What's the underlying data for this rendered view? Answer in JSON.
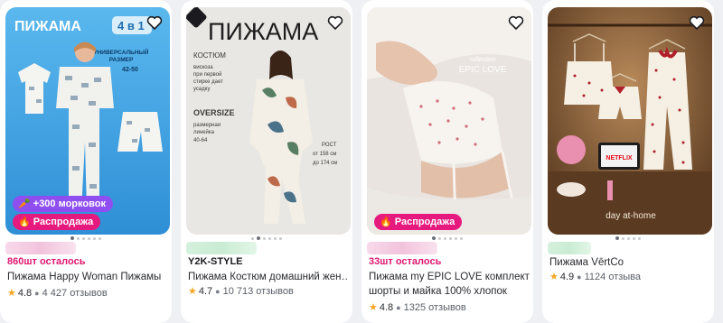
{
  "products": [
    {
      "image_title": "ПИЖАМА",
      "image_badge": "4 в 1",
      "image_note_1": "УНИВЕРСАЛЬНЫЙ",
      "image_note_2": "РАЗМЕР",
      "image_note_3": "42-50",
      "bonus_label": "+300 морковок",
      "sale_label": "Распродажа",
      "stock_text": "860шт осталось",
      "title": "Пижама Happy Woman Пижамы",
      "rating": "4.8",
      "reviews": "4 427 отзывов"
    },
    {
      "image_title": "ПИЖАМА",
      "img_l1": "КОСТЮМ",
      "img_l2": "вискоза",
      "img_l3": "при первой",
      "img_l4": "стирке дает",
      "img_l5": "усадку",
      "img_l6": "OVERSIZE",
      "img_l7": "размерная",
      "img_l8": "линейка",
      "img_l9": "40-64",
      "img_r1": "РОСТ",
      "img_r2": "от 158 см",
      "img_r3": "до 174 см",
      "brand": "Y2K-STYLE",
      "title": "Пижама Костюм домашний жен…",
      "rating": "4.7",
      "reviews": "10 713 отзывов"
    },
    {
      "img_l1": "collection",
      "img_l2": "EPIC LOVE",
      "sale_label": "Распродажа",
      "stock_text": "33шт осталось",
      "title": "Пижама my EPIC LOVE комплект шорты и майка 100% хлопок",
      "rating": "4.8",
      "reviews": "1325 отзывов"
    },
    {
      "img_caption": "day at-home",
      "img_tv": "NETFLIX",
      "title": "Пижама VērtCo",
      "rating": "4.9",
      "reviews": "1124 отзыва"
    }
  ],
  "colors": {
    "sale": "#e61a7e",
    "bonus": "#8f4ff0",
    "stock": "#e0156f",
    "star": "#f5a623"
  }
}
